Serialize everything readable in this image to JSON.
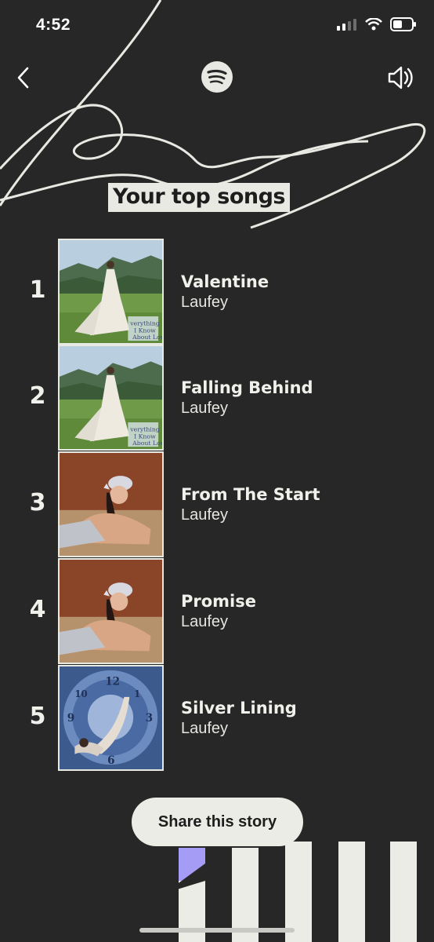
{
  "status_bar": {
    "time": "4:52"
  },
  "header": {
    "title": "Your top songs"
  },
  "songs": [
    {
      "rank": "1",
      "title": "Valentine",
      "artist": "Laufey",
      "cover": "everything-i-know-about-love-cover"
    },
    {
      "rank": "2",
      "title": "Falling Behind",
      "artist": "Laufey",
      "cover": "everything-i-know-about-love-cover"
    },
    {
      "rank": "3",
      "title": "From The Start",
      "artist": "Laufey",
      "cover": "bewitched-cover"
    },
    {
      "rank": "4",
      "title": "Promise",
      "artist": "Laufey",
      "cover": "bewitched-cover"
    },
    {
      "rank": "5",
      "title": "Silver Lining",
      "artist": "Laufey",
      "cover": "silver-lining-cover"
    }
  ],
  "footer": {
    "share_label": "Share this story"
  },
  "colors": {
    "background": "#272727",
    "highlight": "#e9e9e3",
    "accent": "#a49cf5"
  }
}
